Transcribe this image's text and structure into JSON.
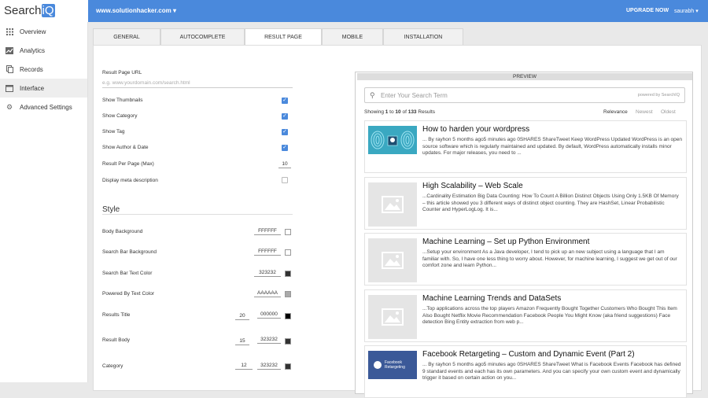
{
  "app": {
    "logo_text": "Search",
    "logo_accent": "iQ",
    "domain": "www.solutionhacker.com ▾",
    "upgrade": "UPGRADE NOW",
    "user": "saurabh ▾",
    "accent": "#4a89dc"
  },
  "sidebar": {
    "items": [
      {
        "label": "Overview",
        "icon": "grid-icon"
      },
      {
        "label": "Analytics",
        "icon": "chart-icon"
      },
      {
        "label": "Records",
        "icon": "copy-icon"
      },
      {
        "label": "Interface",
        "icon": "window-icon"
      },
      {
        "label": "Advanced Settings",
        "icon": "gear-icon"
      }
    ]
  },
  "tabs": [
    "GENERAL",
    "AUTOCOMPLETE",
    "RESULT PAGE",
    "MOBILE",
    "INSTALLATION"
  ],
  "settings": {
    "url_label": "Result Page URL",
    "url_placeholder": "e.g. www.yourdomain.com/search.html",
    "show_thumbnails": "Show Thumbnails",
    "show_category": "Show Category",
    "show_tag": "Show Tag",
    "show_author_date": "Show Author & Date",
    "result_per_page": "Result Per Page (Max)",
    "result_per_page_value": "10",
    "display_meta": "Display meta description",
    "checked": [
      true,
      true,
      true,
      true,
      false
    ]
  },
  "style": {
    "heading": "Style",
    "body_bg": {
      "label": "Body Background",
      "value": "FFFFFF"
    },
    "search_bar_bg": {
      "label": "Search Bar Background",
      "value": "FFFFFF"
    },
    "search_bar_text": {
      "label": "Search Bar Text Color",
      "value": "323232"
    },
    "powered_by": {
      "label": "Powered By Text Color",
      "value": "AAAAAA"
    },
    "results_title": {
      "label": "Results Title",
      "size": "20",
      "value": "000000"
    },
    "result_body": {
      "label": "Result Body",
      "size": "15",
      "value": "323232"
    },
    "category": {
      "label": "Category",
      "size": "12",
      "value": "323232"
    }
  },
  "preview": {
    "header": "PREVIEW",
    "search_placeholder": "Enter Your Search Term",
    "powered_by": "powered by SearchIQ",
    "showing_prefix": "Showing ",
    "showing_from": "1",
    "showing_to_word": " to ",
    "showing_to": "10",
    "showing_of_word": " of ",
    "showing_total": "133",
    "showing_suffix": " Results",
    "sort": [
      "Relevance",
      "Newest",
      "Oldest"
    ],
    "thumb_text": "Facebook Retargeting",
    "results": [
      {
        "title": "How to harden your wordpress",
        "body": "... By rayhon 5 months ago5 minutes ago 0SHARES ShareTweet Keep WordPress Updated WordPress is an open source software which is regularly maintained and updated. By default, WordPress automatically installs minor updates. For major releases, you need to ..."
      },
      {
        "title": "High Scalability – Web Scale",
        "body": "...Cardinality Estimation Big Data Counting: How To Count A Billion Distinct Objects Using Only 1.5KB Of Memory – this article showed you 3 different ways of distinct object counting. They are HashSet, Linear Probabilistic Counter and HyperLogLog. It is..."
      },
      {
        "title": "Machine Learning – Set up Python Environment",
        "body": "...Setup your environment As a Java developer, I tend to pick up an new subject using a language that I am familiar with. So, I have one less thing to worry about. However, for machine learning, I suggest we get out of our comfort zone and learn Python..."
      },
      {
        "title": "Machine Learning Trends and DataSets",
        "body": "...Top applications across the top players Amazon Frequently Bought Together Customers Who Bought This Item Also Bought Netflix Movie Recommendation Facebook People You Might Know (aka friend suggestions) Face detection Bing Entity extraction from web p..."
      },
      {
        "title": "Facebook Retargeting – Custom and Dynamic Event (Part 2)",
        "body": "... By rayhon 5 months ago5 minutes ago 0SHARES ShareTweet What is Facebook Events Facebook has defined 9 standard events and each has its own parameters. And you can specify your own custom event and dynamically trigger it based on certain action on you..."
      }
    ]
  }
}
